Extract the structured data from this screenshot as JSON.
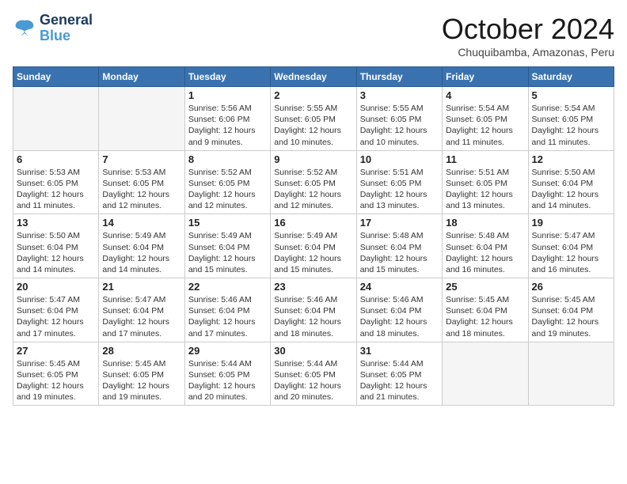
{
  "logo": {
    "line1": "General",
    "line2": "Blue"
  },
  "title": "October 2024",
  "subtitle": "Chuquibamba, Amazonas, Peru",
  "headers": [
    "Sunday",
    "Monday",
    "Tuesday",
    "Wednesday",
    "Thursday",
    "Friday",
    "Saturday"
  ],
  "weeks": [
    [
      {
        "day": "",
        "info": ""
      },
      {
        "day": "",
        "info": ""
      },
      {
        "day": "1",
        "info": "Sunrise: 5:56 AM\nSunset: 6:06 PM\nDaylight: 12 hours and 9 minutes."
      },
      {
        "day": "2",
        "info": "Sunrise: 5:55 AM\nSunset: 6:05 PM\nDaylight: 12 hours and 10 minutes."
      },
      {
        "day": "3",
        "info": "Sunrise: 5:55 AM\nSunset: 6:05 PM\nDaylight: 12 hours and 10 minutes."
      },
      {
        "day": "4",
        "info": "Sunrise: 5:54 AM\nSunset: 6:05 PM\nDaylight: 12 hours and 11 minutes."
      },
      {
        "day": "5",
        "info": "Sunrise: 5:54 AM\nSunset: 6:05 PM\nDaylight: 12 hours and 11 minutes."
      }
    ],
    [
      {
        "day": "6",
        "info": "Sunrise: 5:53 AM\nSunset: 6:05 PM\nDaylight: 12 hours and 11 minutes."
      },
      {
        "day": "7",
        "info": "Sunrise: 5:53 AM\nSunset: 6:05 PM\nDaylight: 12 hours and 12 minutes."
      },
      {
        "day": "8",
        "info": "Sunrise: 5:52 AM\nSunset: 6:05 PM\nDaylight: 12 hours and 12 minutes."
      },
      {
        "day": "9",
        "info": "Sunrise: 5:52 AM\nSunset: 6:05 PM\nDaylight: 12 hours and 12 minutes."
      },
      {
        "day": "10",
        "info": "Sunrise: 5:51 AM\nSunset: 6:05 PM\nDaylight: 12 hours and 13 minutes."
      },
      {
        "day": "11",
        "info": "Sunrise: 5:51 AM\nSunset: 6:05 PM\nDaylight: 12 hours and 13 minutes."
      },
      {
        "day": "12",
        "info": "Sunrise: 5:50 AM\nSunset: 6:04 PM\nDaylight: 12 hours and 14 minutes."
      }
    ],
    [
      {
        "day": "13",
        "info": "Sunrise: 5:50 AM\nSunset: 6:04 PM\nDaylight: 12 hours and 14 minutes."
      },
      {
        "day": "14",
        "info": "Sunrise: 5:49 AM\nSunset: 6:04 PM\nDaylight: 12 hours and 14 minutes."
      },
      {
        "day": "15",
        "info": "Sunrise: 5:49 AM\nSunset: 6:04 PM\nDaylight: 12 hours and 15 minutes."
      },
      {
        "day": "16",
        "info": "Sunrise: 5:49 AM\nSunset: 6:04 PM\nDaylight: 12 hours and 15 minutes."
      },
      {
        "day": "17",
        "info": "Sunrise: 5:48 AM\nSunset: 6:04 PM\nDaylight: 12 hours and 15 minutes."
      },
      {
        "day": "18",
        "info": "Sunrise: 5:48 AM\nSunset: 6:04 PM\nDaylight: 12 hours and 16 minutes."
      },
      {
        "day": "19",
        "info": "Sunrise: 5:47 AM\nSunset: 6:04 PM\nDaylight: 12 hours and 16 minutes."
      }
    ],
    [
      {
        "day": "20",
        "info": "Sunrise: 5:47 AM\nSunset: 6:04 PM\nDaylight: 12 hours and 17 minutes."
      },
      {
        "day": "21",
        "info": "Sunrise: 5:47 AM\nSunset: 6:04 PM\nDaylight: 12 hours and 17 minutes."
      },
      {
        "day": "22",
        "info": "Sunrise: 5:46 AM\nSunset: 6:04 PM\nDaylight: 12 hours and 17 minutes."
      },
      {
        "day": "23",
        "info": "Sunrise: 5:46 AM\nSunset: 6:04 PM\nDaylight: 12 hours and 18 minutes."
      },
      {
        "day": "24",
        "info": "Sunrise: 5:46 AM\nSunset: 6:04 PM\nDaylight: 12 hours and 18 minutes."
      },
      {
        "day": "25",
        "info": "Sunrise: 5:45 AM\nSunset: 6:04 PM\nDaylight: 12 hours and 18 minutes."
      },
      {
        "day": "26",
        "info": "Sunrise: 5:45 AM\nSunset: 6:04 PM\nDaylight: 12 hours and 19 minutes."
      }
    ],
    [
      {
        "day": "27",
        "info": "Sunrise: 5:45 AM\nSunset: 6:05 PM\nDaylight: 12 hours and 19 minutes."
      },
      {
        "day": "28",
        "info": "Sunrise: 5:45 AM\nSunset: 6:05 PM\nDaylight: 12 hours and 19 minutes."
      },
      {
        "day": "29",
        "info": "Sunrise: 5:44 AM\nSunset: 6:05 PM\nDaylight: 12 hours and 20 minutes."
      },
      {
        "day": "30",
        "info": "Sunrise: 5:44 AM\nSunset: 6:05 PM\nDaylight: 12 hours and 20 minutes."
      },
      {
        "day": "31",
        "info": "Sunrise: 5:44 AM\nSunset: 6:05 PM\nDaylight: 12 hours and 21 minutes."
      },
      {
        "day": "",
        "info": ""
      },
      {
        "day": "",
        "info": ""
      }
    ]
  ]
}
